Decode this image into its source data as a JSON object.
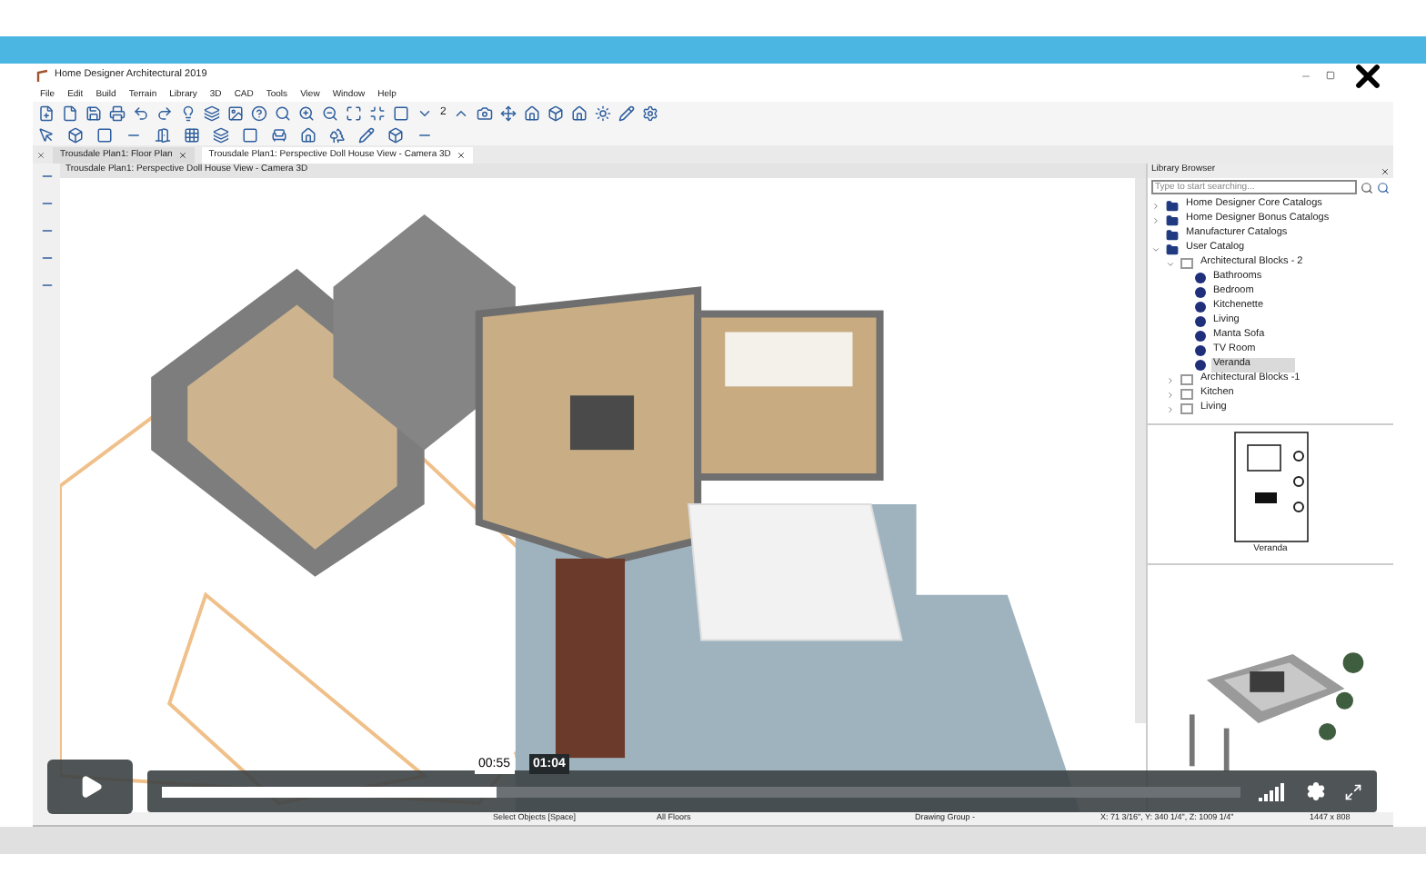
{
  "app": {
    "title": "Home Designer Architectural 2019",
    "menu": [
      "File",
      "Edit",
      "Build",
      "Terrain",
      "Library",
      "3D",
      "CAD",
      "Tools",
      "View",
      "Window",
      "Help"
    ],
    "toolbar_floor": "2",
    "tabs": [
      {
        "label": "Trousdale Plan1: Floor Plan",
        "selected": false
      },
      {
        "label": "Trousdale Plan1: Perspective Doll House View - Camera 3D",
        "selected": true
      }
    ],
    "view_title": "Trousdale Plan1: Perspective Doll House View - Camera 3D",
    "library": {
      "title": "Library Browser",
      "search_placeholder": "Type to start searching...",
      "tree": [
        {
          "label": "Home Designer Core Catalogs",
          "kind": "catalog",
          "expanded": false
        },
        {
          "label": "Home Designer Bonus Catalogs",
          "kind": "catalog",
          "expanded": false
        },
        {
          "label": "Manufacturer Catalogs",
          "kind": "catalog"
        },
        {
          "label": "User Catalog",
          "kind": "catalog",
          "expanded": true,
          "children": [
            {
              "label": "Architectural Blocks - 2",
              "kind": "folder",
              "expanded": true,
              "children": [
                {
                  "label": "Bathrooms",
                  "kind": "item",
                  "selected": false
                },
                {
                  "label": "Bedroom",
                  "kind": "item",
                  "selected": false
                },
                {
                  "label": "Kitchenette",
                  "kind": "item",
                  "selected": false
                },
                {
                  "label": "Living",
                  "kind": "item",
                  "selected": false
                },
                {
                  "label": "Manta Sofa",
                  "kind": "item",
                  "selected": false
                },
                {
                  "label": "TV Room",
                  "kind": "item",
                  "selected": false
                },
                {
                  "label": "Veranda",
                  "kind": "item",
                  "selected": true
                }
              ]
            },
            {
              "label": "Architectural Blocks -1",
              "kind": "folder",
              "expanded": false
            },
            {
              "label": "Kitchen",
              "kind": "folder",
              "expanded": false
            },
            {
              "label": "Living",
              "kind": "folder",
              "expanded": false
            }
          ]
        }
      ],
      "preview_caption": "Veranda"
    },
    "status_bar": [
      "Select Objects [Space]",
      "All Floors",
      "Drawing Group -",
      "X: 71 3/16\", Y: 340 1/4\", Z: 1009 1/4\"",
      "1447 x 808"
    ]
  },
  "player": {
    "playing": false,
    "level": 0.31,
    "hover_time": "00:55",
    "duration": "01:04"
  }
}
